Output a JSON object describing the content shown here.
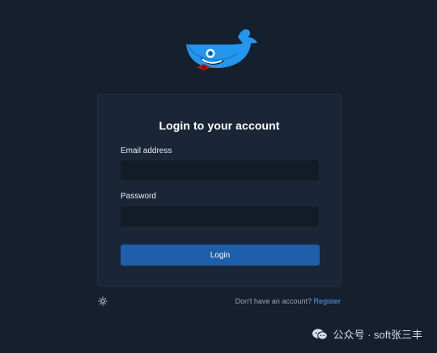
{
  "branding": {
    "logo_icon": "docker-whale-icon",
    "accent": "#2496ed"
  },
  "login": {
    "title": "Login to your account",
    "email_label": "Email address",
    "email_value": "",
    "email_placeholder": "",
    "password_label": "Password",
    "password_value": "",
    "password_placeholder": "",
    "submit_label": "Login"
  },
  "footer": {
    "theme_toggle_icon": "sun-icon",
    "signup_prompt": "Don't have an account?",
    "register_label": "Register"
  },
  "watermark": {
    "icon": "wechat-icon",
    "text": "公众号 · soft张三丰"
  },
  "colors": {
    "background": "#161f2d",
    "card": "#1a2638",
    "input": "#131b27",
    "button": "#1f5ea8",
    "link": "#5a9ee6"
  }
}
